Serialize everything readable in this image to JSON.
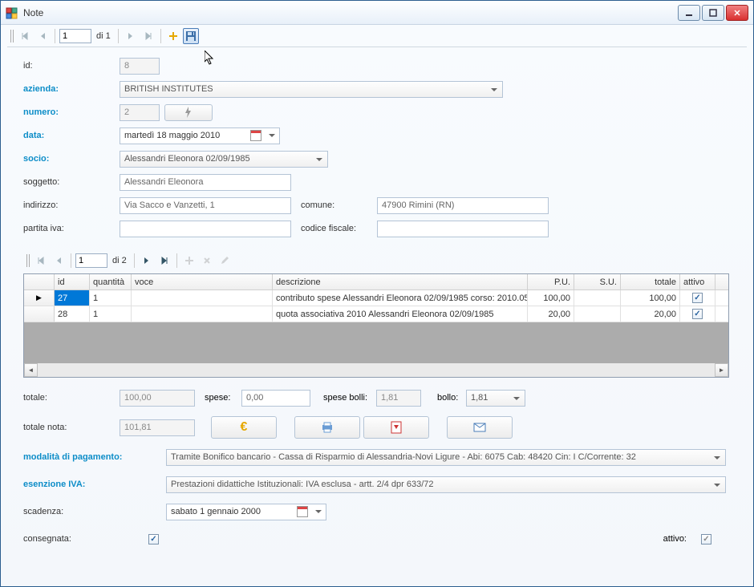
{
  "window": {
    "title": "Note"
  },
  "nav1": {
    "position": "1",
    "count_text": "di 1"
  },
  "nav2": {
    "position": "1",
    "count_text": "di 2"
  },
  "form": {
    "id_label": "id:",
    "id_value": "8",
    "azienda_label": "azienda:",
    "azienda_value": "BRITISH INSTITUTES",
    "numero_label": "numero:",
    "numero_value": "2",
    "data_label": "data:",
    "data_value": "martedì   18   maggio    2010",
    "socio_label": "socio:",
    "socio_value": "Alessandri Eleonora 02/09/1985",
    "soggetto_label": "soggetto:",
    "soggetto_value": "Alessandri Eleonora",
    "indirizzo_label": "indirizzo:",
    "indirizzo_value": "Via Sacco e Vanzetti, 1",
    "comune_label": "comune:",
    "comune_value": "47900 Rimini (RN)",
    "piva_label": "partita iva:",
    "piva_value": "",
    "cf_label": "codice fiscale:",
    "cf_value": ""
  },
  "grid": {
    "columns": {
      "id": "id",
      "quantita": "quantità",
      "voce": "voce",
      "descrizione": "descrizione",
      "pu": "P.U.",
      "su": "S.U.",
      "totale": "totale",
      "attivo": "attivo"
    },
    "rows": [
      {
        "id": "27",
        "quantita": "1",
        "voce": "",
        "descrizione": "contributo spese Alessandri Eleonora 02/09/1985 corso: 2010.05...",
        "pu": "100,00",
        "su": "",
        "totale": "100,00",
        "attivo": true
      },
      {
        "id": "28",
        "quantita": "1",
        "voce": "",
        "descrizione": "quota associativa 2010 Alessandri Eleonora 02/09/1985",
        "pu": "20,00",
        "su": "",
        "totale": "20,00",
        "attivo": true
      }
    ]
  },
  "totals": {
    "totale_label": "totale:",
    "totale_value": "100,00",
    "spese_label": "spese:",
    "spese_value": "0,00",
    "spese_bolli_label": "spese bolli:",
    "spese_bolli_value": "1,81",
    "bollo_label": "bollo:",
    "bollo_value": "1,81",
    "totale_nota_label": "totale nota:",
    "totale_nota_value": "101,81"
  },
  "payment": {
    "modalita_label": "modalità di pagamento:",
    "modalita_value": "Tramite Bonifico bancario - Cassa di Risparmio di Alessandria-Novi Ligure - Abi: 6075 Cab: 48420 Cin: I C/Corrente: 32",
    "esenzione_label": "esenzione IVA:",
    "esenzione_value": "Prestazioni didattiche Istituzionali: IVA esclusa - artt. 2/4 dpr 633/72",
    "scadenza_label": "scadenza:",
    "scadenza_value": "sabato      1   gennaio    2000",
    "consegnata_label": "consegnata:",
    "attivo_label": "attivo:"
  }
}
